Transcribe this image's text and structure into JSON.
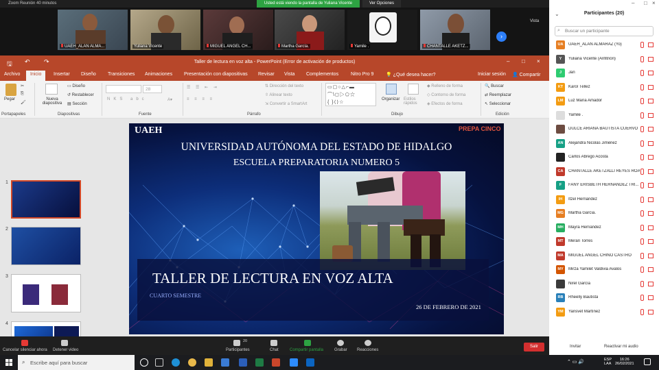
{
  "zoom": {
    "title": "Zoom Reunión 40 minutos",
    "share_banner": "Usted está viendo la pantalla de Yuliana Vicente",
    "view_options": "Ver Opciones",
    "vista": "Vista",
    "gallery": [
      {
        "name": "UAEH_ALAN ALMA..."
      },
      {
        "name": "Yuliana Vicente"
      },
      {
        "name": "MIGUEL ANGEL CH..."
      },
      {
        "name": "Martha García."
      },
      {
        "name": "Yamile ."
      },
      {
        "name": "CHANTALLE AKETZ..."
      }
    ],
    "bottom": {
      "cancel_mute": "Cancelar silenciar ahora",
      "stop_video": "Detener video",
      "participants": "Participantes",
      "participants_count": "20",
      "chat": "Chat",
      "share": "Compartir pantalla",
      "record": "Grabar",
      "reactions": "Reacciones",
      "leave": "Salir"
    }
  },
  "ppt": {
    "title": "Taller de lectura en voz alta - PowerPoint (Error de activación de productos)",
    "tabs": [
      "Archivo",
      "Inicio",
      "Insertar",
      "Diseño",
      "Transiciones",
      "Animaciones",
      "Presentación con diapositivas",
      "Revisar",
      "Vista",
      "Complementos",
      "Nitro Pro 9",
      "¿Qué desea hacer?"
    ],
    "signin": "Iniciar sesión",
    "share": "Compartir",
    "ribbon": {
      "paste": "Pegar",
      "new_slide": "Nueva diapositiva",
      "design": "Diseño",
      "reset": "Restablecer",
      "section": "Sección",
      "font_size": "28",
      "text_direction": "Dirección del texto",
      "align_text": "Alinear texto",
      "smartart": "Convertir a SmartArt",
      "arrange": "Organizar",
      "quick_styles": "Estilos rápidos",
      "shape_fill": "Relleno de forma",
      "shape_outline": "Contorno de forma",
      "shape_effects": "Efectos de forma",
      "find": "Buscar",
      "replace": "Reemplazar",
      "select": "Seleccionar",
      "groups": [
        "Portapapeles",
        "Diapositivas",
        "Fuente",
        "Párrafo",
        "Dibujo",
        "Edición"
      ]
    },
    "thumbnails": [
      "1",
      "2",
      "3",
      "4"
    ],
    "slide": {
      "logo": "UAEH",
      "prepa": "PREPA CINCO",
      "university": "UNIVERSIDAD AUTÓNOMA DEL ESTADO DE HIDALGO",
      "school": "ESCUELA PREPARATORIA NUMERO 5",
      "title": "TALLER DE LECTURA EN VOZ ALTA",
      "semester": "CUARTO SEMESTRE",
      "date": "26 DE FEBRERO DE 2021"
    }
  },
  "participants": {
    "header": "Participantes (20)",
    "search_placeholder": "Buscar un participante",
    "list": [
      {
        "initials": "UA",
        "name": "UAEH_ALAN ALMARAZ (Yo)",
        "color": "#e67e22"
      },
      {
        "initials": "Y",
        "name": "Yuliana Vicente (Anfitrión)",
        "color": "#555555"
      },
      {
        "initials": "J",
        "name": "Jan",
        "color": "#2ecc71"
      },
      {
        "initials": "KT",
        "name": "Karol  Téllez",
        "color": "#f39c12"
      },
      {
        "initials": "LM",
        "name": "Luz María Amador",
        "color": "#f39c12"
      },
      {
        "initials": "",
        "name": "Yamile .",
        "color": "#dddddd"
      },
      {
        "initials": "",
        "name": "DULCE ARIANA BAUTISTA CUERVO",
        "color": "#6d4c41"
      },
      {
        "initials": "AN",
        "name": "Alejandra Nicolás Jiménez",
        "color": "#16a085"
      },
      {
        "initials": "",
        "name": "Carlos Abrego Acosta",
        "color": "#222222"
      },
      {
        "initials": "CA",
        "name": "CHANTALLE AKETZALLI REYES ROA",
        "color": "#c0392b"
      },
      {
        "initials": "F",
        "name": "FANY ERISBETH HERNANDEZ TRI...",
        "color": "#16a085"
      },
      {
        "initials": "IH",
        "name": "Itzel Hernández",
        "color": "#f39c12"
      },
      {
        "initials": "MG",
        "name": "Martha García.",
        "color": "#e67e22"
      },
      {
        "initials": "MH",
        "name": "Mayra Hernández",
        "color": "#27ae60"
      },
      {
        "initials": "MT",
        "name": "Merari Torres",
        "color": "#c0392b"
      },
      {
        "initials": "MA",
        "name": "MIGUEL ANGEL CHINO CASTRO",
        "color": "#c0392b"
      },
      {
        "initials": "MY",
        "name": "Mirza Yamilet Valdivia Avalos",
        "color": "#d35400"
      },
      {
        "initials": "",
        "name": "Nirel García",
        "color": "#3b3b3b"
      },
      {
        "initials": "RB",
        "name": "Rheelly Bautista",
        "color": "#2980b9"
      },
      {
        "initials": "YM",
        "name": "Yarisvet Martínez",
        "color": "#f39c12"
      }
    ],
    "invite": "Invitar",
    "unmute_me": "Reactivar mi audio"
  },
  "taskbar": {
    "search_placeholder": "Escribe aquí para buscar",
    "lang1": "ESP",
    "lang2": "LAA",
    "time": "16:26",
    "date": "26/02/2021"
  }
}
